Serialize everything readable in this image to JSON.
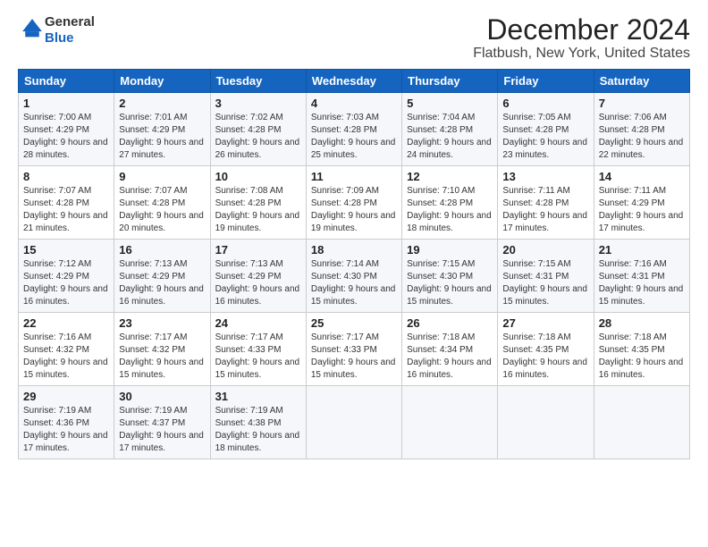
{
  "logo": {
    "general": "General",
    "blue": "Blue"
  },
  "title": "December 2024",
  "subtitle": "Flatbush, New York, United States",
  "weekdays": [
    "Sunday",
    "Monday",
    "Tuesday",
    "Wednesday",
    "Thursday",
    "Friday",
    "Saturday"
  ],
  "weeks": [
    [
      {
        "day": "1",
        "sunrise": "7:00 AM",
        "sunset": "4:29 PM",
        "daylight": "9 hours and 28 minutes."
      },
      {
        "day": "2",
        "sunrise": "7:01 AM",
        "sunset": "4:29 PM",
        "daylight": "9 hours and 27 minutes."
      },
      {
        "day": "3",
        "sunrise": "7:02 AM",
        "sunset": "4:28 PM",
        "daylight": "9 hours and 26 minutes."
      },
      {
        "day": "4",
        "sunrise": "7:03 AM",
        "sunset": "4:28 PM",
        "daylight": "9 hours and 25 minutes."
      },
      {
        "day": "5",
        "sunrise": "7:04 AM",
        "sunset": "4:28 PM",
        "daylight": "9 hours and 24 minutes."
      },
      {
        "day": "6",
        "sunrise": "7:05 AM",
        "sunset": "4:28 PM",
        "daylight": "9 hours and 23 minutes."
      },
      {
        "day": "7",
        "sunrise": "7:06 AM",
        "sunset": "4:28 PM",
        "daylight": "9 hours and 22 minutes."
      }
    ],
    [
      {
        "day": "8",
        "sunrise": "7:07 AM",
        "sunset": "4:28 PM",
        "daylight": "9 hours and 21 minutes."
      },
      {
        "day": "9",
        "sunrise": "7:07 AM",
        "sunset": "4:28 PM",
        "daylight": "9 hours and 20 minutes."
      },
      {
        "day": "10",
        "sunrise": "7:08 AM",
        "sunset": "4:28 PM",
        "daylight": "9 hours and 19 minutes."
      },
      {
        "day": "11",
        "sunrise": "7:09 AM",
        "sunset": "4:28 PM",
        "daylight": "9 hours and 19 minutes."
      },
      {
        "day": "12",
        "sunrise": "7:10 AM",
        "sunset": "4:28 PM",
        "daylight": "9 hours and 18 minutes."
      },
      {
        "day": "13",
        "sunrise": "7:11 AM",
        "sunset": "4:28 PM",
        "daylight": "9 hours and 17 minutes."
      },
      {
        "day": "14",
        "sunrise": "7:11 AM",
        "sunset": "4:29 PM",
        "daylight": "9 hours and 17 minutes."
      }
    ],
    [
      {
        "day": "15",
        "sunrise": "7:12 AM",
        "sunset": "4:29 PM",
        "daylight": "9 hours and 16 minutes."
      },
      {
        "day": "16",
        "sunrise": "7:13 AM",
        "sunset": "4:29 PM",
        "daylight": "9 hours and 16 minutes."
      },
      {
        "day": "17",
        "sunrise": "7:13 AM",
        "sunset": "4:29 PM",
        "daylight": "9 hours and 16 minutes."
      },
      {
        "day": "18",
        "sunrise": "7:14 AM",
        "sunset": "4:30 PM",
        "daylight": "9 hours and 15 minutes."
      },
      {
        "day": "19",
        "sunrise": "7:15 AM",
        "sunset": "4:30 PM",
        "daylight": "9 hours and 15 minutes."
      },
      {
        "day": "20",
        "sunrise": "7:15 AM",
        "sunset": "4:31 PM",
        "daylight": "9 hours and 15 minutes."
      },
      {
        "day": "21",
        "sunrise": "7:16 AM",
        "sunset": "4:31 PM",
        "daylight": "9 hours and 15 minutes."
      }
    ],
    [
      {
        "day": "22",
        "sunrise": "7:16 AM",
        "sunset": "4:32 PM",
        "daylight": "9 hours and 15 minutes."
      },
      {
        "day": "23",
        "sunrise": "7:17 AM",
        "sunset": "4:32 PM",
        "daylight": "9 hours and 15 minutes."
      },
      {
        "day": "24",
        "sunrise": "7:17 AM",
        "sunset": "4:33 PM",
        "daylight": "9 hours and 15 minutes."
      },
      {
        "day": "25",
        "sunrise": "7:17 AM",
        "sunset": "4:33 PM",
        "daylight": "9 hours and 15 minutes."
      },
      {
        "day": "26",
        "sunrise": "7:18 AM",
        "sunset": "4:34 PM",
        "daylight": "9 hours and 16 minutes."
      },
      {
        "day": "27",
        "sunrise": "7:18 AM",
        "sunset": "4:35 PM",
        "daylight": "9 hours and 16 minutes."
      },
      {
        "day": "28",
        "sunrise": "7:18 AM",
        "sunset": "4:35 PM",
        "daylight": "9 hours and 16 minutes."
      }
    ],
    [
      {
        "day": "29",
        "sunrise": "7:19 AM",
        "sunset": "4:36 PM",
        "daylight": "9 hours and 17 minutes."
      },
      {
        "day": "30",
        "sunrise": "7:19 AM",
        "sunset": "4:37 PM",
        "daylight": "9 hours and 17 minutes."
      },
      {
        "day": "31",
        "sunrise": "7:19 AM",
        "sunset": "4:38 PM",
        "daylight": "9 hours and 18 minutes."
      },
      null,
      null,
      null,
      null
    ]
  ],
  "labels": {
    "sunrise": "Sunrise:",
    "sunset": "Sunset:",
    "daylight": "Daylight:"
  }
}
